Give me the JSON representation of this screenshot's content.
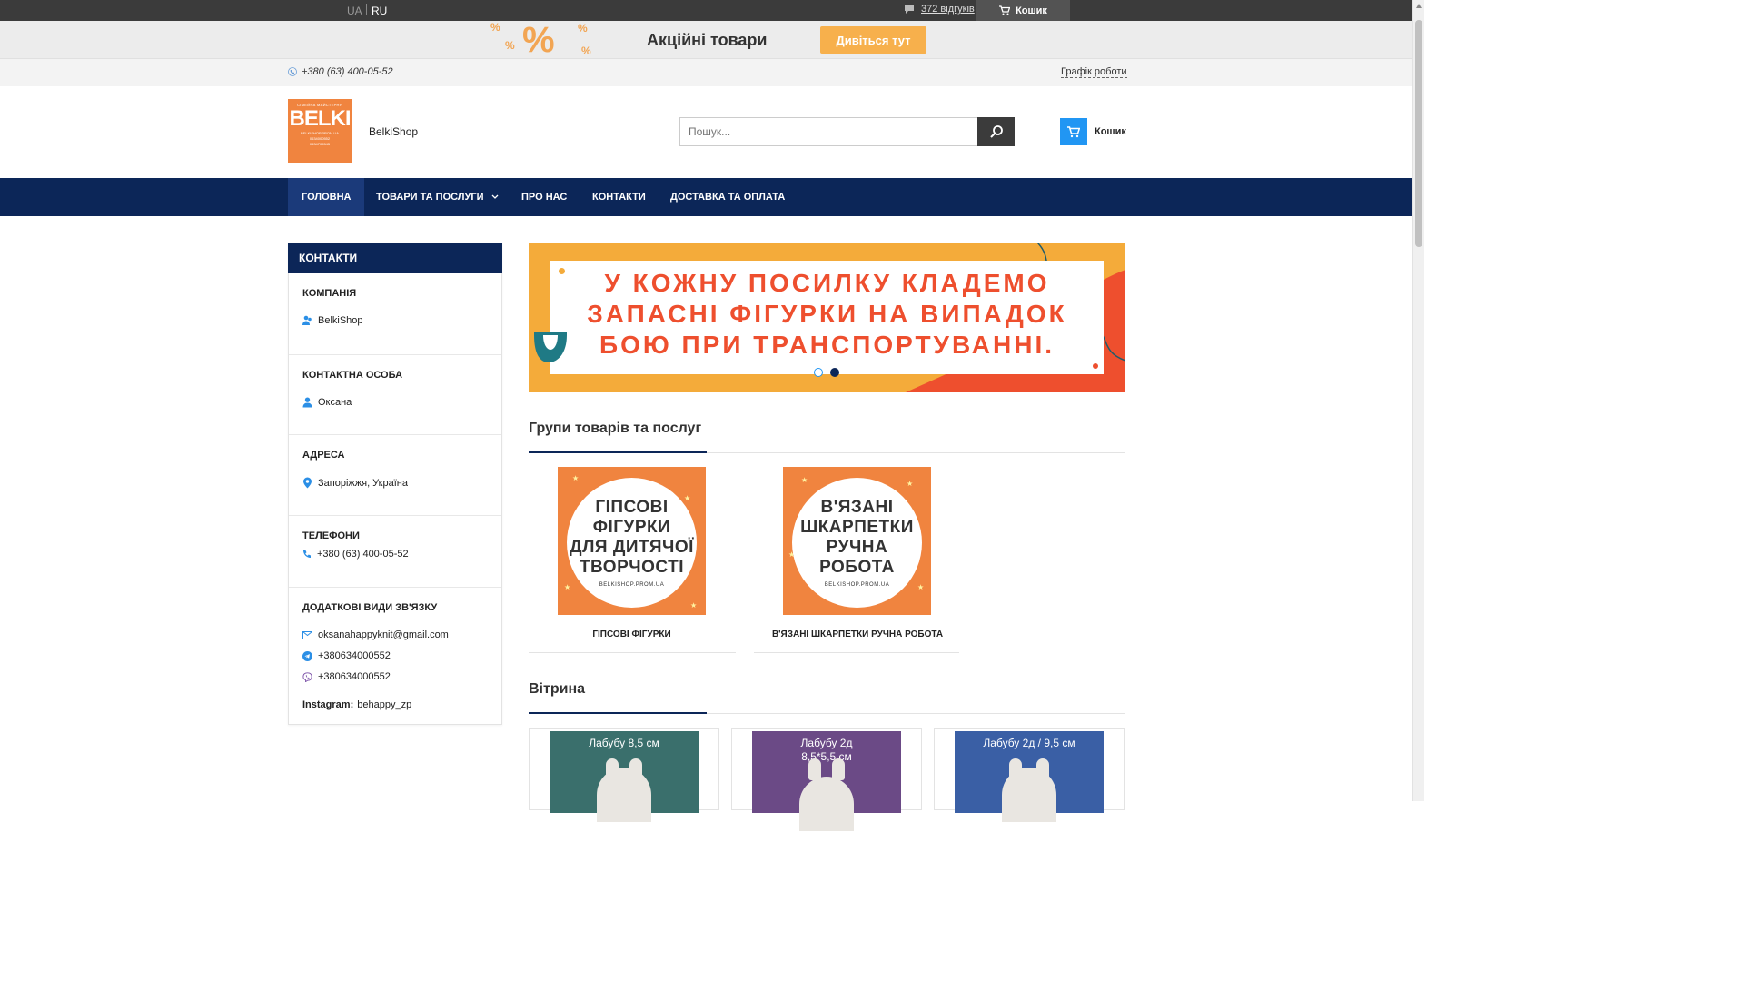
{
  "topbar": {
    "lang_ua": "UA",
    "lang_ru": "RU",
    "reviews_link": "372 відгуків",
    "cart_label": "Кошик"
  },
  "promo": {
    "title": "Акційні товари",
    "button": "Дивіться тут"
  },
  "infobar": {
    "phone": "+380 (63) 400-05-52",
    "schedule": "Графік роботи"
  },
  "header": {
    "logo": {
      "top_text": "СІМЕЙНА МАЙСТЕРНЯ",
      "brand": "BELKI",
      "url": "BELKISHOP.PROM.UA",
      "phone1": "0634000552",
      "phone2": "0634705545"
    },
    "shop_name": "BelkiShop",
    "search_placeholder": "Пошук...",
    "cart_label": "Кошик"
  },
  "nav": {
    "items": [
      {
        "label": "ГОЛОВНА"
      },
      {
        "label": "ТОВАРИ ТА ПОСЛУГИ"
      },
      {
        "label": "ПРО НАС"
      },
      {
        "label": "КОНТАКТИ"
      },
      {
        "label": "ДОСТАВКА ТА ОПЛАТА"
      }
    ]
  },
  "sidebar": {
    "title": "КОНТАКТИ",
    "company_title": "КОМПАНІЯ",
    "company_name": "BelkiShop",
    "person_title": "КОНТАКТНА ОСОБА",
    "person_name": "Оксана",
    "address_title": "АДРЕСА",
    "address": "Запоріжжя, Україна",
    "phones_title": "ТЕЛЕФОНИ",
    "phone": "+380 (63) 400-05-52",
    "extra_title": "ДОДАТКОВІ ВИДИ ЗВ'ЯЗКУ",
    "email": "oksanahappyknit@gmail.com",
    "telegram": "+380634000552",
    "viber": "+380634000552",
    "instagram_label": "Instagram:",
    "instagram_value": "behappy_zp"
  },
  "slider": {
    "line1": "У КОЖНУ ПОСИЛКУ КЛАДЕМО",
    "line2": "ЗАПАСНІ ФІГУРКИ НА ВИПАДОК",
    "line3": "БОЮ ПРИ ТРАНСПОРТУВАННІ.",
    "dot1": "1",
    "dot2": "2",
    "active_slide": 2
  },
  "groups": {
    "title": "Групи товарів та послуг",
    "items": [
      {
        "image_line1": "ГІПСОВІ",
        "image_line2": "ФІГУРКИ",
        "image_line3": "ДЛЯ ДИТЯЧОЇ",
        "image_line4": "ТВОРЧОСТІ",
        "image_url": "BELKISHOP.PROM.UA",
        "label": "ГІПСОВІ ФІГУРКИ"
      },
      {
        "image_line1": "В'ЯЗАНІ",
        "image_line2": "ШКАРПЕТКИ",
        "image_line3": "РУЧНА РОБОТА",
        "image_url": "BELKISHOP.PROM.UA",
        "label": "В'ЯЗАНІ ШКАРПЕТКИ РУЧНА РОБОТА"
      }
    ]
  },
  "showcase": {
    "title": "Вітрина",
    "products": [
      {
        "line1": "Лабубу 8,5 см",
        "line2": "",
        "color": "#3a6f6c"
      },
      {
        "line1": "Лабубу 2д",
        "line2": "8,5*5,5 см",
        "color": "#6b4a86"
      },
      {
        "line1": "Лабубу 2д / 9,5 см",
        "line2": "",
        "color": "#3a5fa5"
      }
    ]
  },
  "colors": {
    "navy": "#0c2658",
    "orange": "#f0843f",
    "accent_blue": "#2196f3",
    "promo_orange": "#f7b04c"
  }
}
